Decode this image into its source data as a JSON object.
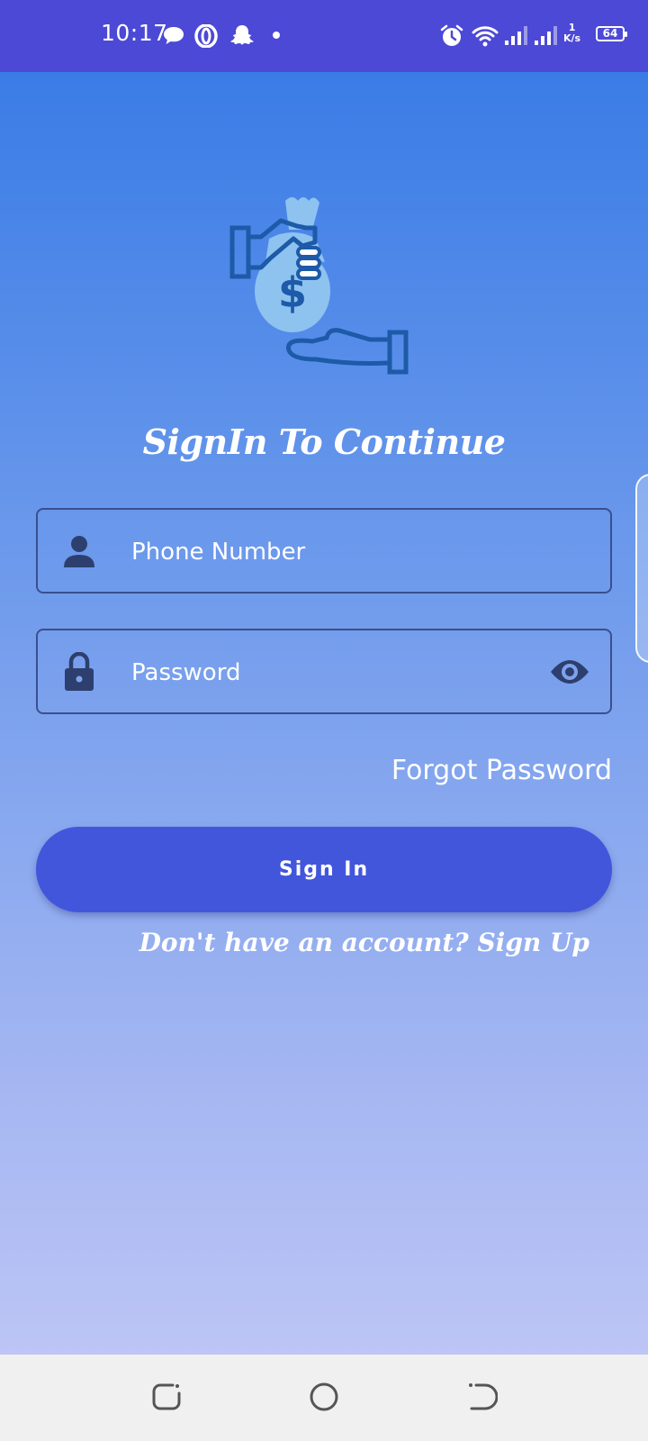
{
  "status_bar": {
    "time": "10:17",
    "netspeed_value": "1",
    "netspeed_unit": "K/s",
    "battery": "64",
    "icons": [
      "message-bubble-icon",
      "opera-icon",
      "snapchat-icon",
      "dot-icon",
      "alarm-icon",
      "wifi-icon",
      "signal-icon",
      "signal-icon"
    ]
  },
  "screen": {
    "title": "SignIn To Continue",
    "phone_field": {
      "placeholder": "Phone Number",
      "icon": "person-icon"
    },
    "password_field": {
      "placeholder": "Password",
      "icon": "lock-icon",
      "toggle_icon": "eye-icon"
    },
    "forgot_password": "Forgot Password",
    "signin_button": "Sign In",
    "signup_link": "Don't have an account? Sign Up"
  },
  "nav_bar": {
    "buttons": [
      "recents-button",
      "home-button",
      "back-button"
    ]
  },
  "colors": {
    "status_bar": "#4c49d6",
    "button": "#4256dc",
    "field_border": "#3a4f8f",
    "gradient_top": "#3a7ce6",
    "gradient_bottom": "#bcc5f5"
  }
}
